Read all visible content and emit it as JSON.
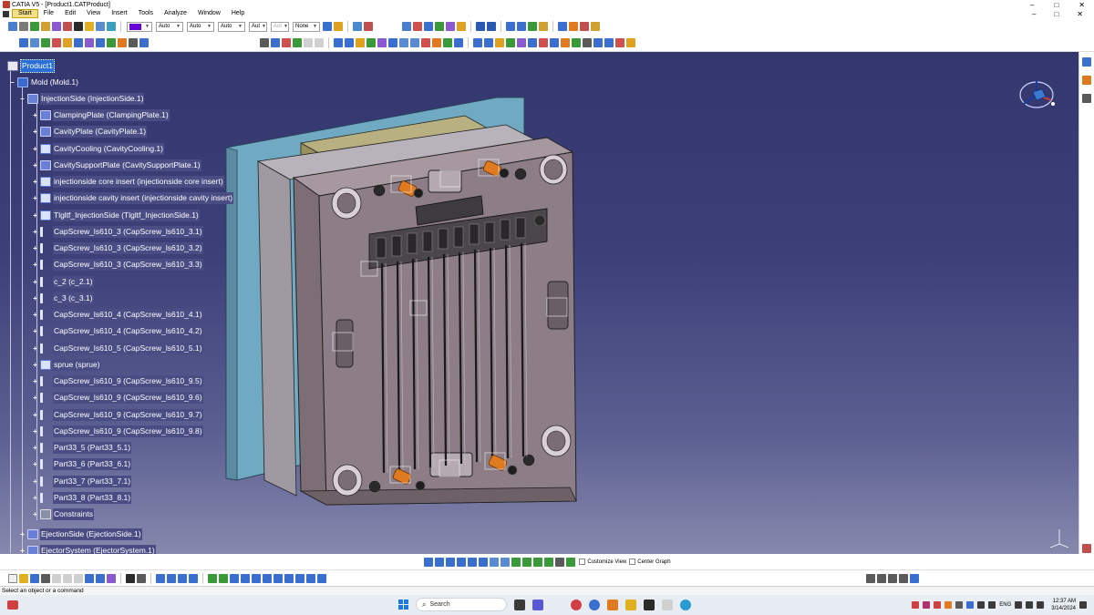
{
  "window": {
    "title": "CATIA V5 - [Product1.CATProduct]",
    "controls": [
      "–",
      "□",
      "✕"
    ]
  },
  "menubar": {
    "items": [
      "Start",
      "File",
      "Edit",
      "View",
      "Insert",
      "Tools",
      "Analyze",
      "Window",
      "Help"
    ],
    "mdi_controls": [
      "–",
      "□",
      "✕"
    ]
  },
  "toolbar": {
    "color_value": "",
    "transparency_value": "Auto",
    "linetype_value": "Auto",
    "lineweight_value": "Auto",
    "point_value": "Aut",
    "layer_value": "Aut",
    "rendering_value": "None"
  },
  "tree": {
    "root": "Product1",
    "mold": "Mold (Mold.1)",
    "injection_side": "InjectionSide (InjectionSide.1)",
    "children": [
      {
        "label": "ClampingPlate (ClampingPlate.1)",
        "icon": "part-icon"
      },
      {
        "label": "CavityPlate (CavityPlate.1)",
        "icon": "part-icon"
      },
      {
        "label": "CavityCooling (CavityCooling.1)",
        "icon": "assembly-icon"
      },
      {
        "label": "CavitySupportPlate (CavitySupportPlate.1)",
        "icon": "part-icon"
      },
      {
        "label": "injectionside core insert (injectionside core insert)",
        "icon": "component-icon"
      },
      {
        "label": "injectionside cavity insert (injectionside cavity insert)",
        "icon": "component-icon"
      },
      {
        "label": "Tlgltf_InjectionSide (Tlgltf_InjectionSide.1)",
        "icon": "assembly-icon"
      },
      {
        "label": "CapScrew_ls610_3 (CapScrew_ls610_3.1)",
        "icon": "screw-icon"
      },
      {
        "label": "CapScrew_ls610_3 (CapScrew_ls610_3.2)",
        "icon": "screw-icon"
      },
      {
        "label": "CapScrew_ls610_3 (CapScrew_ls610_3.3)",
        "icon": "screw-icon"
      },
      {
        "label": "c_2 (c_2.1)",
        "icon": "cup-icon"
      },
      {
        "label": "c_3 (c_3.1)",
        "icon": "cup-icon"
      },
      {
        "label": "CapScrew_ls610_4 (CapScrew_ls610_4.1)",
        "icon": "screw-icon"
      },
      {
        "label": "CapScrew_ls610_4 (CapScrew_ls610_4.2)",
        "icon": "screw-icon"
      },
      {
        "label": "CapScrew_ls610_5 (CapScrew_ls610_5.1)",
        "icon": "screw-icon"
      },
      {
        "label": "sprue (sprue)",
        "icon": "component-icon"
      },
      {
        "label": "CapScrew_ls610_9 (CapScrew_ls610_9.5)",
        "icon": "screw-icon"
      },
      {
        "label": "CapScrew_ls610_9 (CapScrew_ls610_9.6)",
        "icon": "screw-icon"
      },
      {
        "label": "CapScrew_ls610_9 (CapScrew_ls610_9.7)",
        "icon": "screw-icon"
      },
      {
        "label": "CapScrew_ls610_9 (CapScrew_ls610_9.8)",
        "icon": "screw-icon"
      },
      {
        "label": "Part33_5 (Part33_5.1)",
        "icon": "cup-icon"
      },
      {
        "label": "Part33_6 (Part33_6.1)",
        "icon": "cup-icon"
      },
      {
        "label": "Part33_7 (Part33_7.1)",
        "icon": "cup-icon"
      },
      {
        "label": "Part33_8 (Part33_8.1)",
        "icon": "cup-icon"
      },
      {
        "label": "Constraints",
        "icon": "constraints-icon"
      }
    ],
    "ejection_side": "EjectionSide (EjectionSide.1)",
    "ejector_system": "EjectorSystem (EjectorSystem.1)"
  },
  "bottom_toolbar": {
    "customize_view": "Customize View",
    "center_graph": "Center Graph"
  },
  "status": {
    "prompt": "Select an object or a command"
  },
  "taskbar": {
    "search_placeholder": "Search",
    "language": "ENG",
    "time": "12:37 AM",
    "date": "3/14/2024"
  },
  "colors": {
    "viewport_top": "#34366e",
    "viewport_bottom": "#8688ad",
    "selection_blue": "#2a6fd6",
    "tree_highlight": "#494d84",
    "mold_plate": "#8c7d86",
    "back_plate": "#6fa9c2",
    "screw_orange": "#e07a20"
  }
}
